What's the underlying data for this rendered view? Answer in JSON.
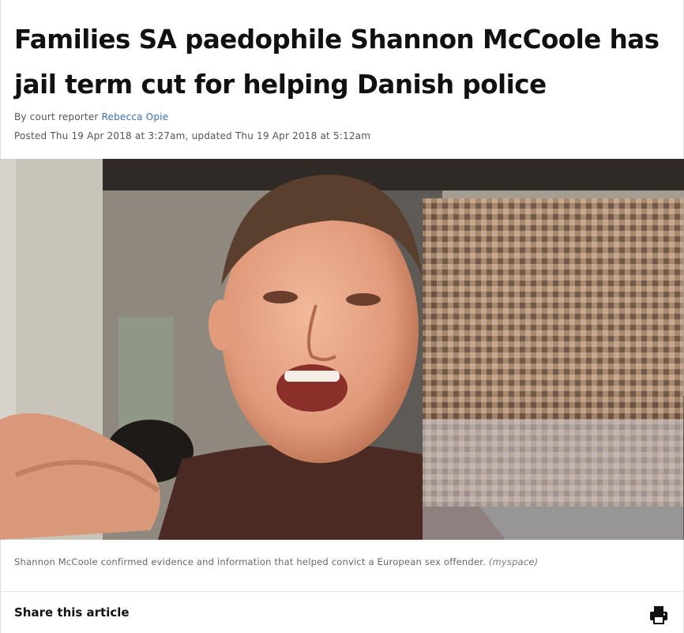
{
  "article": {
    "headline": "Families SA paedophile Shannon McCoole has jail term cut for helping Danish police",
    "byline_prefix": "By court reporter ",
    "author": "Rebecca Opie",
    "dateline": "Posted Thu 19 Apr 2018 at 3:27am, updated Thu 19 Apr 2018 at 5:12am"
  },
  "image": {
    "caption": "Shannon McCoole confirmed evidence and information that helped convict a European sex offender. ",
    "source": "(myspace)"
  },
  "share": {
    "label": "Share this article",
    "print_icon": "print-icon"
  },
  "colors": {
    "link": "#3a6fb4",
    "text": "#111111",
    "muted": "#555555"
  }
}
